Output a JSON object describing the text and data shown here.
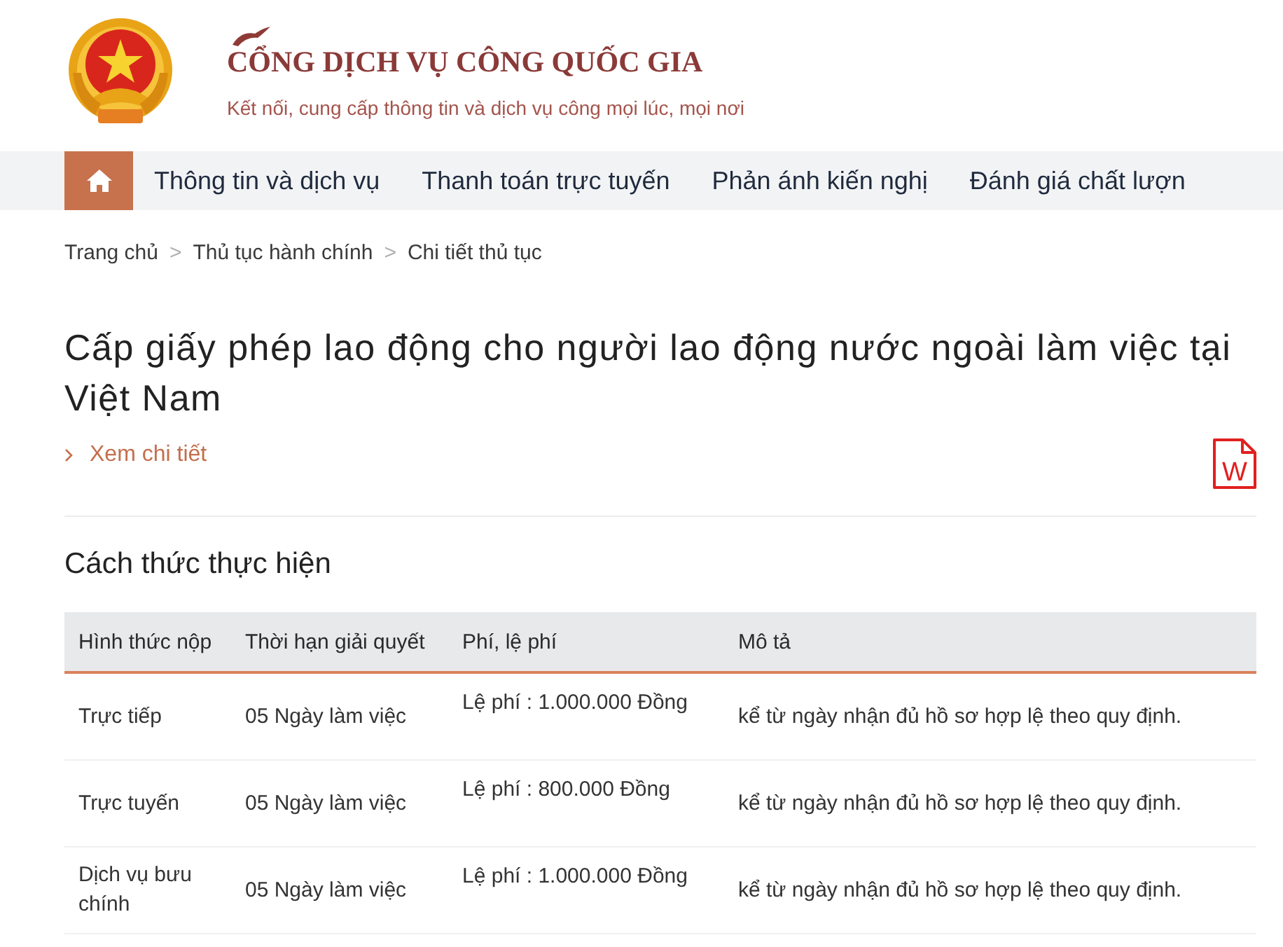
{
  "header": {
    "title": "CỔNG DỊCH VỤ CÔNG QUỐC GIA",
    "tagline": "Kết nối, cung cấp thông tin và dịch vụ công mọi lúc, mọi nơi"
  },
  "nav": [
    {
      "kind": "home",
      "selected": true
    },
    {
      "kind": "link",
      "label": "Thông tin và dịch vụ",
      "selected": false
    },
    {
      "kind": "link",
      "label": "Thanh toán trực tuyến",
      "selected": false
    },
    {
      "kind": "link",
      "label": "Phản ánh kiến nghị",
      "selected": false
    },
    {
      "kind": "link",
      "label": "Đánh giá chất lượn",
      "selected": false
    }
  ],
  "breadcrumb": {
    "separator": ">",
    "items": [
      "Trang chủ",
      "Thủ tục hành chính",
      "Chi tiết thủ tục"
    ]
  },
  "procedure": {
    "title": "Cấp giấy phép lao động cho người lao động nước ngoài làm việc tại Việt Nam",
    "detail_link": "Xem chi tiết",
    "file_icon_letter": "W"
  },
  "section": {
    "title": "Cách thức thực hiện",
    "table": {
      "columns": [
        "Hình thức nộp",
        "Thời hạn giải quyết",
        "Phí, lệ phí",
        "Mô tả"
      ],
      "rows": [
        [
          "Trực tiếp",
          "05 Ngày làm việc",
          "Lệ phí : 1.000.000 Đồng",
          "kể từ ngày nhận đủ hồ sơ hợp lệ theo quy định."
        ],
        [
          "Trực tuyến",
          "05 Ngày làm việc",
          "Lệ phí : 800.000 Đồng",
          "kể từ ngày nhận đủ hồ sơ hợp lệ theo quy định."
        ],
        [
          "Dịch vụ bưu chính",
          "05 Ngày làm việc",
          "Lệ phí : 1.000.000 Đồng",
          "kể từ ngày nhận đủ hồ sơ hợp lệ theo quy định."
        ]
      ]
    }
  }
}
